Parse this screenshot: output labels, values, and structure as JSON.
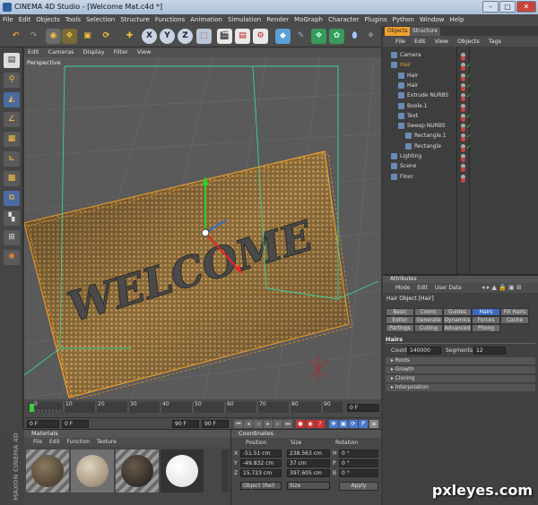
{
  "window": {
    "title": "CINEMA 4D Studio - [Welcome Mat.c4d *]",
    "minimize": "–",
    "maximize": "□",
    "close": "✕"
  },
  "menubar": [
    "File",
    "Edit",
    "Objects",
    "Tools",
    "Selection",
    "Structure",
    "Functions",
    "Animation",
    "Simulation",
    "Render",
    "MoGraph",
    "Character",
    "Plugins",
    "Python",
    "Window",
    "Help"
  ],
  "toolbar": {
    "buttons": [
      "undo-icon",
      "redo-icon",
      "live-selection-icon",
      "move-icon",
      "scale-icon",
      "rotate-icon",
      "add-icon",
      "x-axis-icon",
      "y-axis-icon",
      "z-axis-icon",
      "coordinate-system-icon",
      "render-view-icon",
      "render-picture-icon",
      "render-settings-icon",
      "cube-icon",
      "pen-icon",
      "subdivision-icon",
      "array-icon",
      "deformer-icon",
      "light-icon"
    ],
    "axis_labels": [
      "X",
      "Y",
      "Z"
    ]
  },
  "viewport": {
    "menu": [
      "Edit",
      "Cameras",
      "Display",
      "Filter",
      "View"
    ],
    "label": "Perspective",
    "mat_text": "WELCOME"
  },
  "timeline": {
    "ticks": [
      "0",
      "10",
      "20",
      "30",
      "40",
      "50",
      "60",
      "70",
      "80",
      "90"
    ],
    "end_field": "0 F"
  },
  "playbar": {
    "current": "0 F",
    "min": "0 F",
    "max": "90 F",
    "end": "90 F"
  },
  "materials": {
    "title": "Materials",
    "menu": [
      "File",
      "Edit",
      "Function",
      "Texture"
    ],
    "swatches": [
      "hair-material",
      "wood-material",
      "hair-material-2",
      "white-material"
    ]
  },
  "coordinates": {
    "title": "Coordinates",
    "headers": [
      "Position",
      "Size",
      "Rotation"
    ],
    "rows": [
      {
        "axis": "X",
        "pos": "-51.51 cm",
        "size": "238.563 cm",
        "rlabel": "H",
        "rot": "0 °"
      },
      {
        "axis": "Y",
        "pos": "-49.832 cm",
        "size": "37 cm",
        "rlabel": "P",
        "rot": "0 °"
      },
      {
        "axis": "Z",
        "pos": "15.723 cm",
        "size": "397.605 cm",
        "rlabel": "B",
        "rot": "0 °"
      }
    ],
    "mode": "Object (Rel)",
    "size_mode": "Size",
    "apply": "Apply"
  },
  "maxon": "MAXON CINEMA 4D",
  "objects": {
    "tabs": [
      "Objects",
      "Structure"
    ],
    "menu": [
      "File",
      "Edit",
      "View",
      "Objects",
      "Tags"
    ],
    "items": [
      {
        "name": "Camera",
        "indent": 0,
        "color": "#ddd"
      },
      {
        "name": "Hair",
        "indent": 0,
        "color": "#e0a040"
      },
      {
        "name": "Hair",
        "indent": 1,
        "color": "#ddd"
      },
      {
        "name": "Hair",
        "indent": 1,
        "color": "#ddd"
      },
      {
        "name": "Extrude NURBS",
        "indent": 1,
        "color": "#ddd"
      },
      {
        "name": "Boole.1",
        "indent": 1,
        "color": "#ddd"
      },
      {
        "name": "Text",
        "indent": 1,
        "color": "#ddd"
      },
      {
        "name": "Sweep NURBS",
        "indent": 1,
        "color": "#ddd"
      },
      {
        "name": "Rectangle.1",
        "indent": 2,
        "color": "#ddd"
      },
      {
        "name": "Rectangle",
        "indent": 2,
        "color": "#ddd"
      },
      {
        "name": "Lighting",
        "indent": 0,
        "color": "#ddd"
      },
      {
        "name": "Scene",
        "indent": 0,
        "color": "#ddd"
      },
      {
        "name": "Floor",
        "indent": 0,
        "color": "#ddd"
      }
    ]
  },
  "attributes": {
    "title": "Attributes",
    "menu": [
      "Mode",
      "Edit",
      "User Data"
    ],
    "object": "Hair Object [Hair]",
    "tabs_row1": [
      "Basic",
      "Coord.",
      "Guides",
      "Hairs",
      "Fill Hairs"
    ],
    "tabs_row2": [
      "Editor",
      "Generate",
      "Dynamics",
      "Forces",
      "Cache"
    ],
    "tabs_row3": [
      "Partings",
      "Culling",
      "Advanced",
      "Phong"
    ],
    "section": "Hairs",
    "count_label": "Count",
    "count": "140000",
    "segments_label": "Segments",
    "segments": "12",
    "groups": [
      "Roots",
      "Growth",
      "Cloning",
      "Interpolation"
    ]
  },
  "watermark": "pxleyes.com"
}
